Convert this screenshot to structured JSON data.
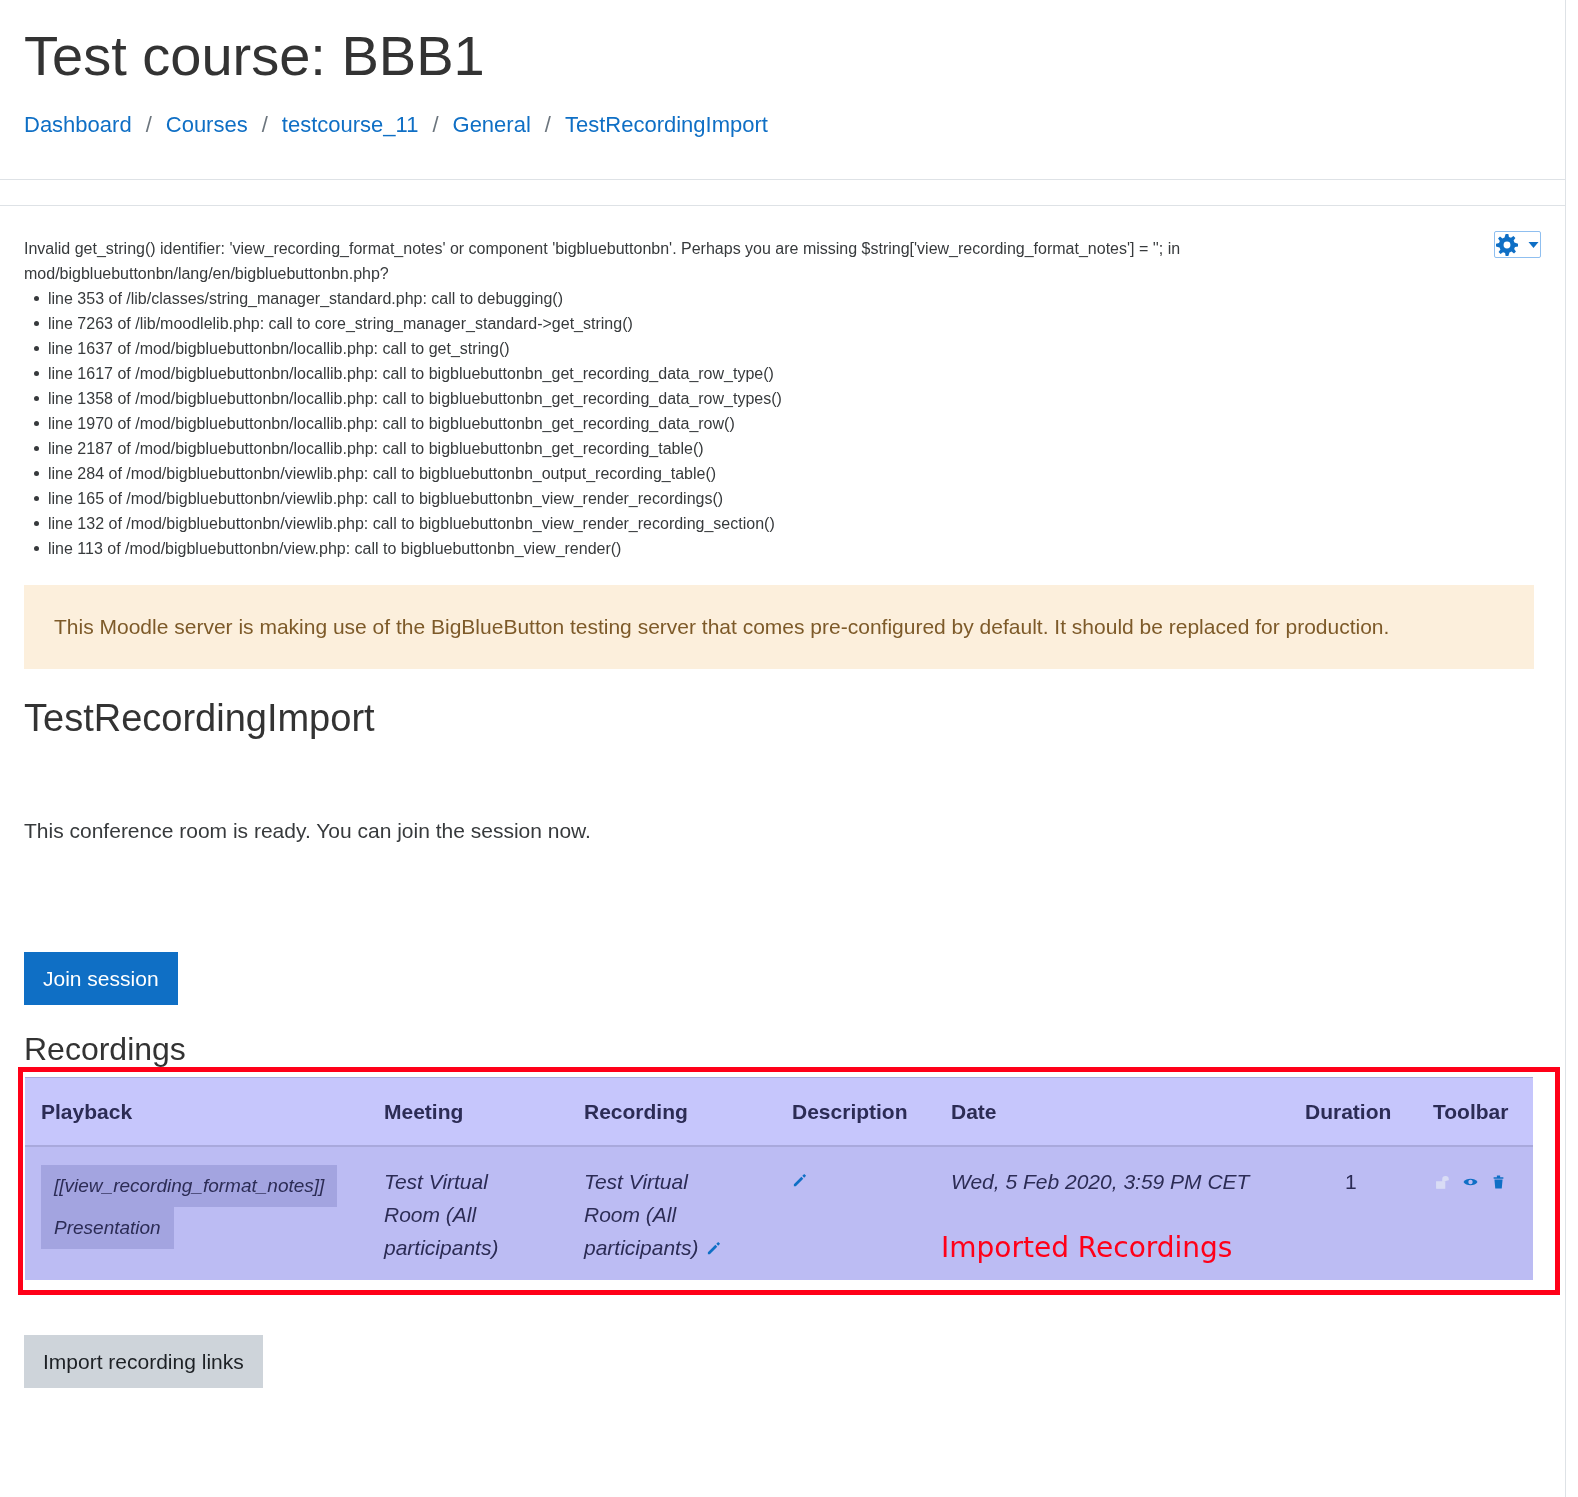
{
  "header": {
    "title": "Test course: BBB1",
    "breadcrumb_separator": "/",
    "breadcrumbs": [
      "Dashboard",
      "Courses",
      "testcourse_11",
      "General",
      "TestRecordingImport"
    ]
  },
  "debug": {
    "message": "Invalid get_string() identifier: 'view_recording_format_notes' or component 'bigbluebuttonbn'. Perhaps you are missing $string['view_recording_format_notes'] = ''; in mod/bigbluebuttonbn/lang/en/bigbluebuttonbn.php?",
    "trace": [
      "line 353 of /lib/classes/string_manager_standard.php: call to debugging()",
      "line 7263 of /lib/moodlelib.php: call to core_string_manager_standard->get_string()",
      "line 1637 of /mod/bigbluebuttonbn/locallib.php: call to get_string()",
      "line 1617 of /mod/bigbluebuttonbn/locallib.php: call to bigbluebuttonbn_get_recording_data_row_type()",
      "line 1358 of /mod/bigbluebuttonbn/locallib.php: call to bigbluebuttonbn_get_recording_data_row_types()",
      "line 1970 of /mod/bigbluebuttonbn/locallib.php: call to bigbluebuttonbn_get_recording_data_row()",
      "line 2187 of /mod/bigbluebuttonbn/locallib.php: call to bigbluebuttonbn_get_recording_table()",
      "line 284 of /mod/bigbluebuttonbn/viewlib.php: call to bigbluebuttonbn_output_recording_table()",
      "line 165 of /mod/bigbluebuttonbn/viewlib.php: call to bigbluebuttonbn_view_render_recordings()",
      "line 132 of /mod/bigbluebuttonbn/viewlib.php: call to bigbluebuttonbn_view_render_recording_section()",
      "line 113 of /mod/bigbluebuttonbn/view.php: call to bigbluebuttonbn_view_render()"
    ]
  },
  "alert": "This Moodle server is making use of the BigBlueButton testing server that comes pre-configured by default. It should be replaced for production.",
  "activity_title": "TestRecordingImport",
  "status": "This conference room is ready. You can join the session now.",
  "join_button": "Join session",
  "recordings": {
    "heading": "Recordings",
    "columns": [
      "Playback",
      "Meeting",
      "Recording",
      "Description",
      "Date",
      "Duration",
      "Toolbar"
    ],
    "rows": [
      {
        "playback": [
          "[[view_recording_format_notes]]",
          "Presentation"
        ],
        "meeting": "Test Virtual Room (All participants)",
        "recording": "Test Virtual Room (All participants)",
        "date": "Wed, 5 Feb 2020, 3:59 PM CET",
        "duration": "1"
      }
    ],
    "annotation": "Imported Recordings"
  },
  "import_button": "Import recording links"
}
